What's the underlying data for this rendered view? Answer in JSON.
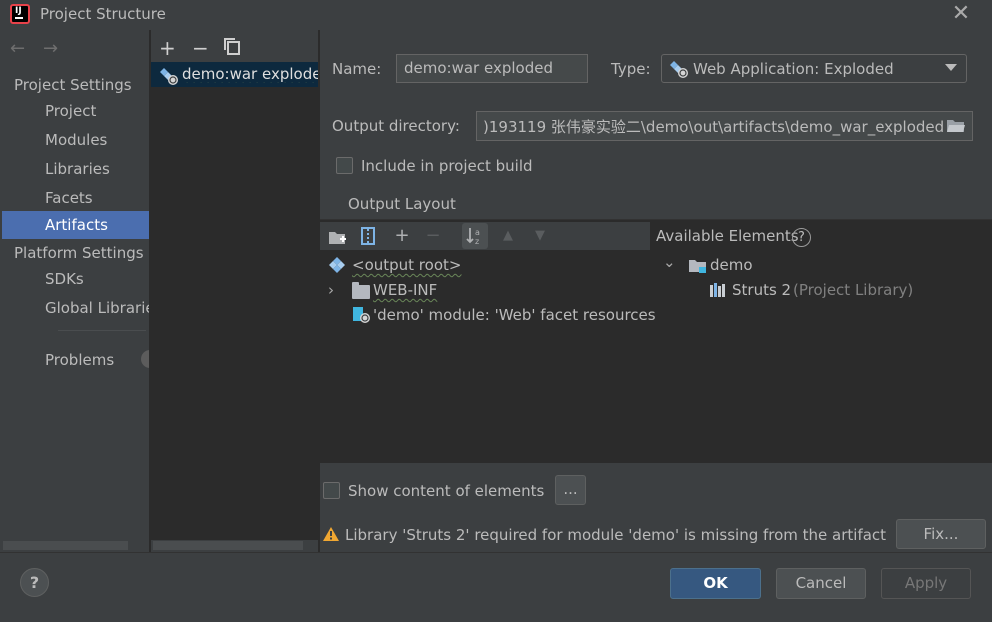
{
  "window": {
    "title": "Project Structure"
  },
  "left_nav": {
    "project_settings_header": "Project Settings",
    "platform_settings_header": "Platform Settings",
    "items": [
      {
        "label": "Project"
      },
      {
        "label": "Modules"
      },
      {
        "label": "Libraries"
      },
      {
        "label": "Facets"
      },
      {
        "label": "Artifacts",
        "selected": true
      }
    ],
    "platform_items": [
      {
        "label": "SDKs"
      },
      {
        "label": "Global Librarie"
      }
    ],
    "problems_label": "Problems"
  },
  "artifact_list": {
    "items": [
      {
        "label": "demo:war exploded",
        "selected": true
      }
    ]
  },
  "form": {
    "name_label": "Name:",
    "name_value": "demo:war exploded",
    "type_label": "Type:",
    "type_value": "Web Application: Exploded",
    "output_dir_label": "Output directory:",
    "output_dir_value": ")193119 张伟豪实验二\\demo\\out\\artifacts\\demo_war_exploded",
    "include_build_label": "Include in project build",
    "include_build_checked": false,
    "output_layout_tab": "Output Layout"
  },
  "layout_tree": [
    {
      "label": "<output root>",
      "icon": "output-root-icon"
    },
    {
      "label": "WEB-INF",
      "icon": "folder-icon",
      "expandable": true
    },
    {
      "label": "'demo' module: 'Web' facet resources",
      "icon": "web-facet-icon"
    }
  ],
  "available": {
    "header": "Available Elements",
    "help_glyph": "?",
    "tree": [
      {
        "label": "demo",
        "icon": "module-folder-icon",
        "expanded": true
      },
      {
        "label": "Struts 2",
        "suffix": "(Project Library)",
        "icon": "library-icon"
      }
    ]
  },
  "footer": {
    "show_content_label": "Show content of elements",
    "show_content_checked": false,
    "ellipsis_button": "...",
    "warning_text": "Library 'Struts 2' required for module 'demo' is missing from the artifact",
    "fix_button": "Fix...",
    "ok_button": "OK",
    "cancel_button": "Cancel",
    "apply_button": "Apply",
    "help_glyph": "?"
  },
  "colors": {
    "selection": "#4b6eaf",
    "background": "#3c3f41",
    "panel_dark": "#2b2b2b",
    "primary_button": "#365880",
    "warning": "#f0a732"
  }
}
